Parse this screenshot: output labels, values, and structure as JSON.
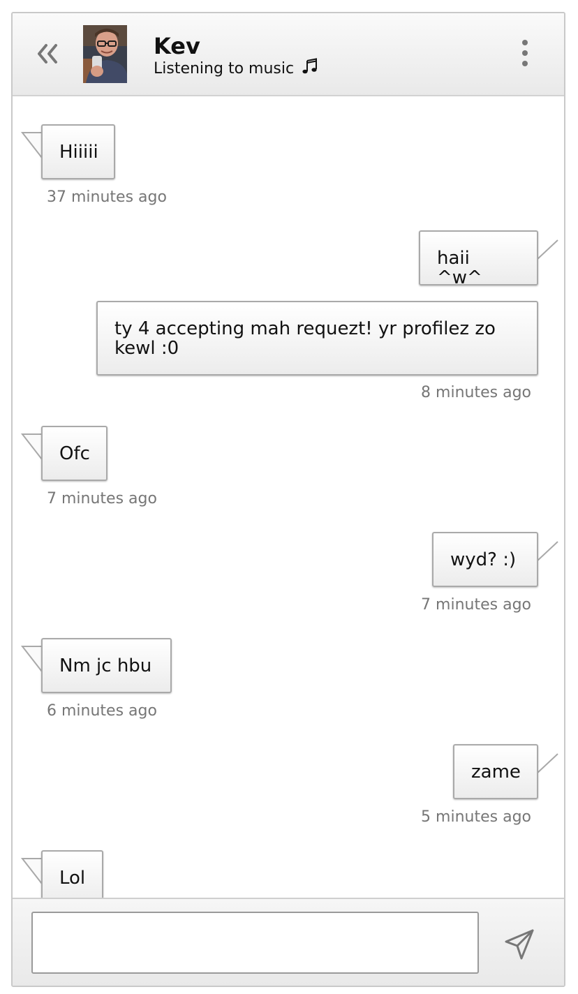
{
  "contact": {
    "name": "Kev",
    "status": "Listening to music",
    "status_icon": "music-note-icon"
  },
  "icons": {
    "back": "double-chevron-left-icon",
    "menu": "vertical-ellipsis-icon",
    "send": "paper-plane-icon"
  },
  "messages": [
    {
      "direction": "incoming",
      "text": "Hiiiii",
      "time": "37 minutes ago"
    },
    {
      "direction": "outgoing",
      "text": "haii ^w^",
      "time": ""
    },
    {
      "direction": "outgoing",
      "text": "ty 4 accepting mah requezt! yr profilez zo kewl :0",
      "time": "8 minutes ago"
    },
    {
      "direction": "incoming",
      "text": "Ofc",
      "time": "7 minutes ago"
    },
    {
      "direction": "outgoing",
      "text": "wyd? :)",
      "time": "7 minutes ago"
    },
    {
      "direction": "incoming",
      "text": "Nm jc hbu",
      "time": "6 minutes ago"
    },
    {
      "direction": "outgoing",
      "text": "zame",
      "time": "5 minutes ago"
    },
    {
      "direction": "incoming",
      "text": "Lol",
      "time": ""
    }
  ],
  "composer": {
    "value": "",
    "placeholder": ""
  },
  "colors": {
    "bubble_border": "#a9a9a9",
    "timestamp": "#767676",
    "icon_gray": "#777777"
  }
}
